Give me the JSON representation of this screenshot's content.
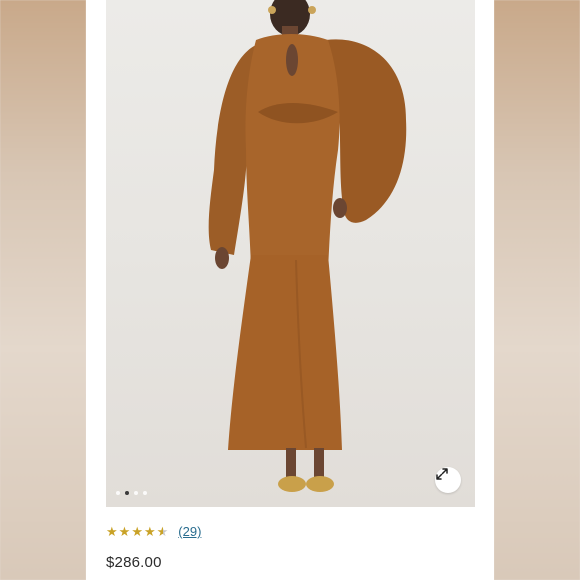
{
  "product": {
    "image_alt_icon": "dress-photo",
    "carousel": {
      "count": 4,
      "active_index": 1
    },
    "expand_icon": "expand-icon",
    "rating": {
      "value": 4.5,
      "max": 5,
      "reviews_label": "(29)"
    },
    "price": "$286.00"
  },
  "colors": {
    "dress": "#a8652b",
    "star": "#c9a227",
    "link": "#2a6d8f"
  }
}
